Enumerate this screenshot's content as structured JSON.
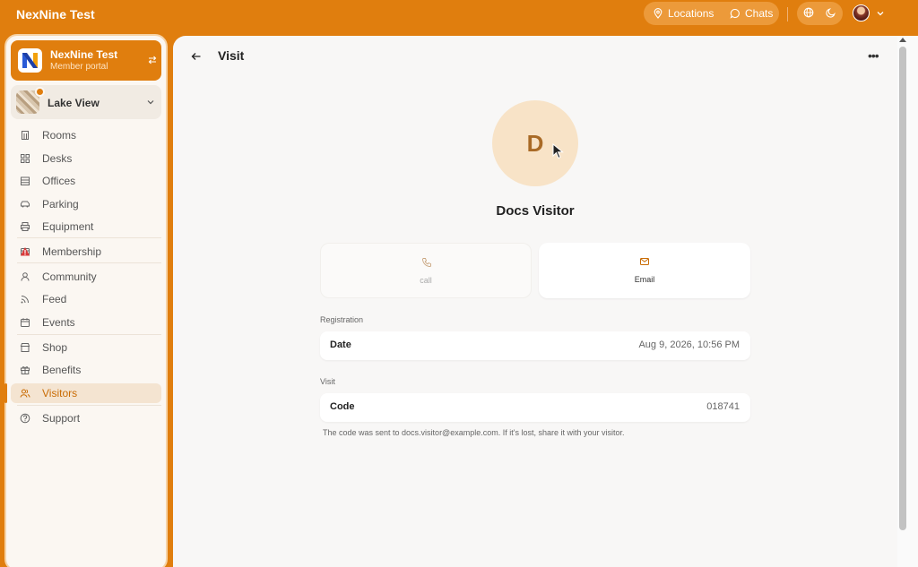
{
  "topbar": {
    "app_title": "NexNine Test",
    "locations_label": "Locations",
    "chats_label": "Chats",
    "icons": [
      "map-pin-icon",
      "chat-icon",
      "globe-icon",
      "moon-icon",
      "chevron-down-icon"
    ]
  },
  "sidebar": {
    "org_name": "NexNine Test",
    "org_subtitle": "Member portal",
    "location_name": "Lake View",
    "items": [
      {
        "label": "Rooms",
        "icon": "building-icon"
      },
      {
        "label": "Desks",
        "icon": "grid-icon"
      },
      {
        "label": "Offices",
        "icon": "office-icon"
      },
      {
        "label": "Parking",
        "icon": "car-icon"
      },
      {
        "label": "Equipment",
        "icon": "printer-icon"
      },
      {
        "label": "Membership",
        "icon": "card-icon",
        "warning": true
      },
      {
        "label": "Community",
        "icon": "user-icon"
      },
      {
        "label": "Feed",
        "icon": "rss-icon"
      },
      {
        "label": "Events",
        "icon": "calendar-icon"
      },
      {
        "label": "Shop",
        "icon": "shop-icon"
      },
      {
        "label": "Benefits",
        "icon": "gift-icon"
      },
      {
        "label": "Visitors",
        "icon": "users-icon",
        "active": true
      },
      {
        "label": "Support",
        "icon": "help-icon"
      }
    ]
  },
  "main": {
    "title": "Visit",
    "avatar_initial": "D",
    "visitor_name": "Docs Visitor",
    "actions": {
      "call_label": "call",
      "email_label": "Email"
    },
    "registration": {
      "section_label": "Registration",
      "key": "Date",
      "value": "Aug 9, 2026, 10:56 PM"
    },
    "visit": {
      "section_label": "Visit",
      "key": "Code",
      "value": "018741"
    },
    "note": "The code was sent to docs.visitor@example.com. If it's lost, share it with your visitor."
  },
  "colors": {
    "brand": "#e07e0e",
    "active_text": "#c96c05",
    "warning": "#d93a3a",
    "avatar_bg": "#f8e3c7"
  }
}
